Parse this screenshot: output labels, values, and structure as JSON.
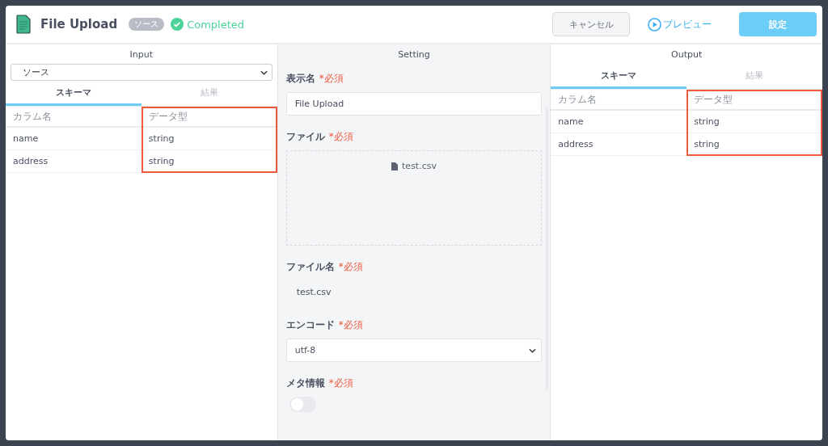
{
  "header": {
    "title": "File Upload",
    "badge": "ソース",
    "status": {
      "kind": "completed",
      "label": "Completed"
    },
    "buttons": [
      {
        "kind": "secondary",
        "label": "キャンセル"
      },
      {
        "kind": "link",
        "label": "プレビュー"
      },
      {
        "kind": "primary",
        "label": "設定"
      }
    ]
  },
  "input": {
    "title": "Input",
    "source_select": "ソース",
    "tabs": [
      {
        "label": "スキーマ",
        "selected": true
      },
      {
        "label": "結果",
        "selected": false
      }
    ],
    "columns": [
      {
        "label": "カラム名",
        "highlighted": false
      },
      {
        "label": "データ型",
        "highlighted": true
      }
    ],
    "rows": [
      [
        "name",
        "string"
      ],
      [
        "address",
        "string"
      ]
    ]
  },
  "setting": {
    "title": "Setting",
    "fields": [
      {
        "kind": "text",
        "label": "表示名",
        "required_mark": "*必須",
        "value": "File Upload"
      },
      {
        "kind": "file",
        "label": "ファイル",
        "required_mark": "*必須",
        "value": "test.csv"
      },
      {
        "kind": "static",
        "label": "ファイル名",
        "required_mark": "*必須",
        "value": "test.csv"
      },
      {
        "kind": "select",
        "label": "エンコード",
        "required_mark": "*必須",
        "value": "utf-8"
      },
      {
        "kind": "toggle",
        "label": "メタ情報",
        "required_mark": "*必須",
        "on": false
      }
    ]
  },
  "output": {
    "title": "Output",
    "tabs": [
      {
        "label": "スキーマ",
        "selected": true
      },
      {
        "label": "結果",
        "selected": false
      }
    ],
    "columns": [
      {
        "label": "カラム名",
        "highlighted": false
      },
      {
        "label": "データ型",
        "highlighted": true
      }
    ],
    "rows": [
      [
        "name",
        "string"
      ],
      [
        "address",
        "string"
      ]
    ]
  }
}
